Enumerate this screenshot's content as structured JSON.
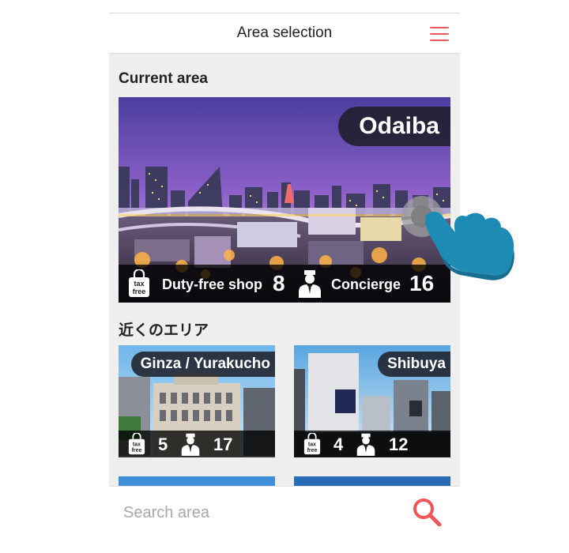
{
  "header": {
    "title": "Area selection",
    "menu_icon": "hamburger-menu-icon"
  },
  "current_area": {
    "heading": "Current area",
    "name": "Odaiba",
    "duty_free_label": "Duty-free shop",
    "duty_free_count": "8",
    "concierge_label": "Concierge",
    "concierge_count": "16"
  },
  "nearby": {
    "heading": "近くのエリア",
    "areas": [
      {
        "name": "Ginza / Yurakucho",
        "duty_free_count": "5",
        "concierge_count": "17"
      },
      {
        "name": "Shibuya",
        "duty_free_count": "4",
        "concierge_count": "12"
      }
    ]
  },
  "tax_icon": {
    "line1": "tax",
    "line2": "free"
  },
  "search": {
    "placeholder": "Search area",
    "icon": "search-icon"
  },
  "colors": {
    "accent": "#f0565b",
    "hand": "#1e8bb5",
    "badge": "#1c1c26"
  }
}
